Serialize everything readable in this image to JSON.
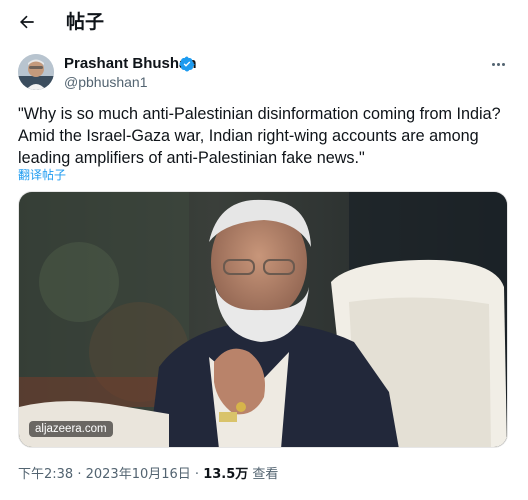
{
  "header": {
    "title": "帖子"
  },
  "tweet": {
    "author": {
      "display_name": "Prashant Bhushan",
      "handle": "@pbhushan1",
      "verified": true
    },
    "text": "\"Why is so much anti-Palestinian disinformation coming from India? Amid the Israel-Gaza war, Indian right-wing accounts are among leading amplifiers of anti-Palestinian fake news.\"",
    "translate_label": "翻译帖子",
    "media": {
      "source": "aljazeera.com"
    },
    "meta": {
      "time": "下午2:38",
      "separator1": " · ",
      "date": "2023年10月16日",
      "separator2": " · ",
      "views_count": "13.5万",
      "views_label": " 查看"
    }
  },
  "colors": {
    "accent": "#1d9bf0",
    "text": "#0f1419",
    "secondary": "#536471"
  },
  "icons": {
    "back": "arrow-left-icon",
    "verified": "verified-badge-icon",
    "more": "more-horizontal-icon"
  }
}
